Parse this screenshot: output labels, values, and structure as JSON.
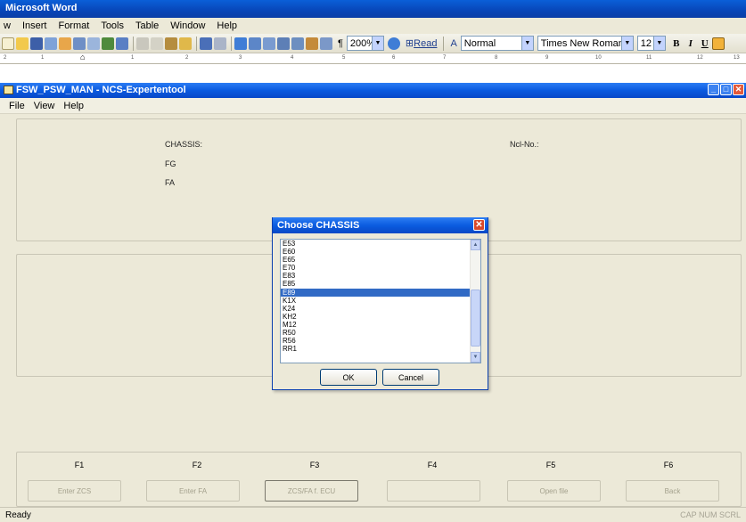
{
  "word": {
    "title": "Microsoft Word",
    "menu": [
      "w",
      "Insert",
      "Format",
      "Tools",
      "Table",
      "Window",
      "Help"
    ],
    "zoom": "200%",
    "read_label": "Read",
    "style": "Normal",
    "font": "Times New Roman",
    "size": "12",
    "bold": "B",
    "italic": "I",
    "underline": "U",
    "ruler_numbers": [
      "2",
      "1",
      "1",
      "2",
      "3",
      "4",
      "5",
      "6",
      "7",
      "8",
      "9",
      "10",
      "11",
      "12",
      "13",
      "14"
    ]
  },
  "ncs": {
    "title": "FSW_PSW_MAN - NCS-Expertentool",
    "menu": [
      "File",
      "View",
      "Help"
    ],
    "labels": {
      "chassis": "CHASSIS:",
      "fg": "FG",
      "fa": "FA",
      "nrl": "Ncl-No.:"
    },
    "function_keys": [
      "F1",
      "F2",
      "F3",
      "F4",
      "F5",
      "F6"
    ],
    "function_buttons": [
      "Enter ZCS",
      "Enter FA",
      "ZCS/FA f. ECU",
      "",
      "Open file",
      "Back"
    ],
    "status": "Ready",
    "status_keys": "CAP NUM SCRL"
  },
  "dialog": {
    "title": "Choose CHASSIS",
    "items": [
      "E53",
      "E60",
      "E65",
      "E70",
      "E83",
      "E85",
      "E89",
      "K1X",
      "K24",
      "KH2",
      "M12",
      "R50",
      "R56",
      "RR1"
    ],
    "selected_index": 6,
    "ok_label": "OK",
    "cancel_label": "Cancel"
  },
  "colors": {
    "title_blue": "#0a5ae0",
    "selection": "#316ac5",
    "face": "#ece9d8"
  }
}
